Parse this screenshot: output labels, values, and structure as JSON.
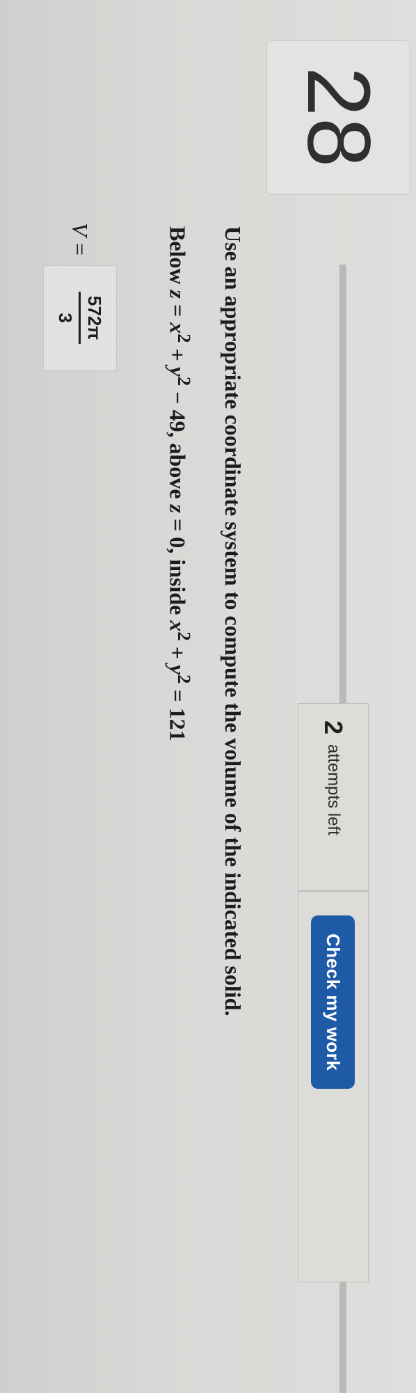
{
  "question": {
    "number": "28"
  },
  "attempts": {
    "count": "2",
    "label": "attempts left"
  },
  "actions": {
    "check_label": "Check my work"
  },
  "problem": {
    "instruction": "Use an appropriate coordinate system to compute the volume of the indicated solid.",
    "prefix": "Below",
    "surface_lhs": "z",
    "eq": " = ",
    "surface_rhs_x": "x",
    "surface_rhs_y": "y",
    "exp": "2",
    "plus": " + ",
    "minus_const": " − 49, above ",
    "plane_var": "z",
    "plane_rhs": " = 0, inside ",
    "circle_rhs": " = 121"
  },
  "answer": {
    "label": "V =",
    "numerator": "572π",
    "denominator": "3"
  },
  "colors": {
    "accent": "#1f5aa6",
    "background": "#d9dad7"
  }
}
